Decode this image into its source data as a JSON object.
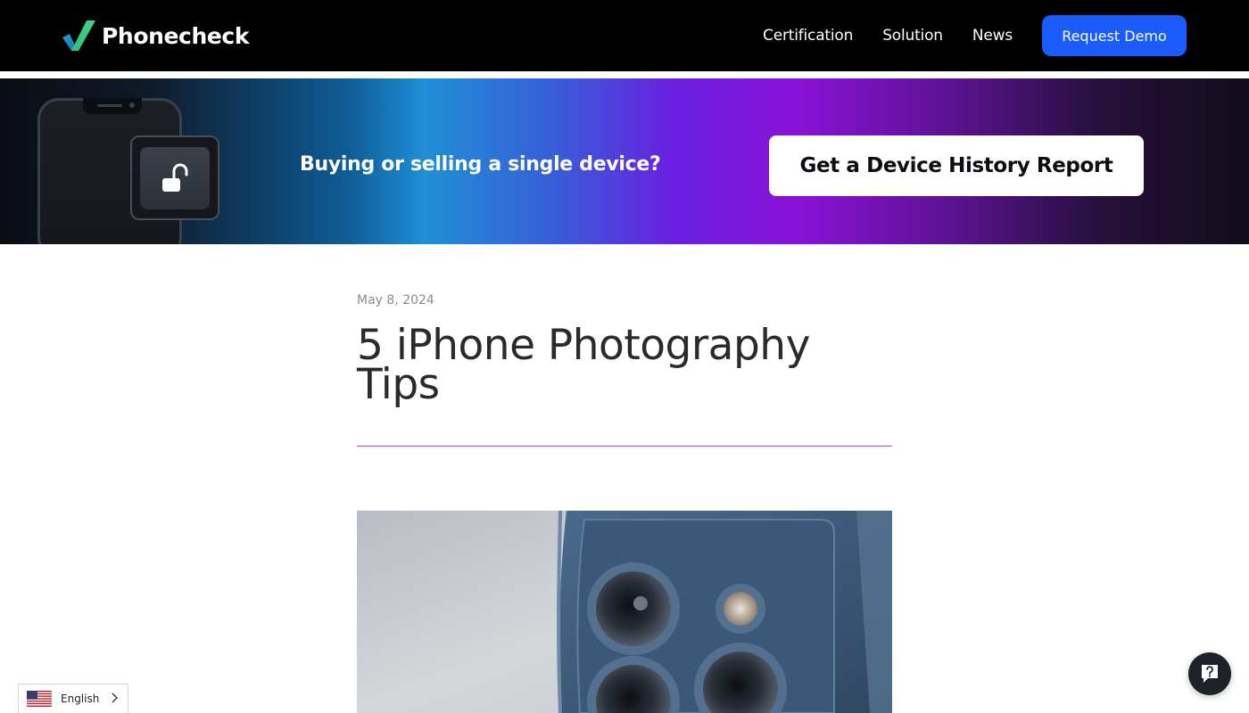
{
  "brand": {
    "name": "Phonecheck",
    "accent_green": "#2ec27e",
    "cta_blue": "#1a5cff"
  },
  "header": {
    "nav": [
      {
        "label": "Certification"
      },
      {
        "label": "Solution"
      },
      {
        "label": "News"
      }
    ],
    "cta_label": "Request Demo"
  },
  "banner": {
    "headline": "Buying or selling a single device?",
    "cta_label": "Get a Device History Report",
    "icons": [
      "phone-icon",
      "unlock-icon"
    ]
  },
  "article": {
    "date": "May 8, 2024",
    "title": "5 iPhone Photography Tips",
    "divider_color": "#b43fd8",
    "hero_image": "iphone-camera-closeup"
  },
  "language": {
    "selected": "English",
    "flag": "us-flag-icon"
  },
  "help": {
    "icon": "help-chat-icon"
  }
}
